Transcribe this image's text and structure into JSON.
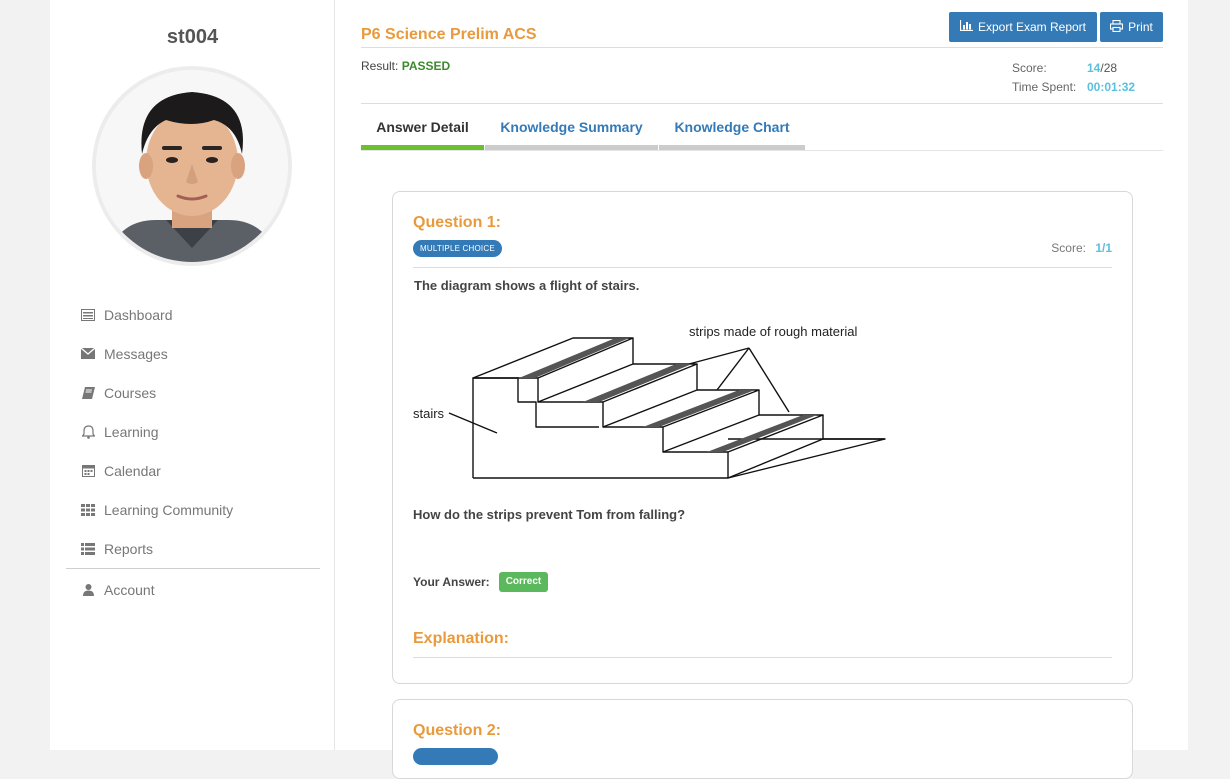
{
  "sidebar": {
    "username": "st004",
    "nav": [
      {
        "label": "Dashboard",
        "icon": "dashboard-icon"
      },
      {
        "label": "Messages",
        "icon": "envelope-icon"
      },
      {
        "label": "Courses",
        "icon": "book-icon"
      },
      {
        "label": "Learning",
        "icon": "bell-icon"
      },
      {
        "label": "Calendar",
        "icon": "calendar-icon"
      },
      {
        "label": "Learning Community",
        "icon": "grid-icon"
      },
      {
        "label": "Reports",
        "icon": "list-icon"
      }
    ],
    "account": {
      "label": "Account",
      "icon": "user-icon"
    }
  },
  "header": {
    "exam_title": "P6 Science Prelim ACS",
    "export_label": "Export Exam Report",
    "print_label": "Print",
    "result_label": "Result:",
    "result_value": "PASSED",
    "score_label": "Score:",
    "score_value": "14",
    "score_total": "/28",
    "time_label": "Time Spent:",
    "time_value": "00:01:32"
  },
  "tabs": [
    {
      "label": "Answer Detail",
      "active": true
    },
    {
      "label": "Knowledge Summary",
      "active": false
    },
    {
      "label": "Knowledge Chart",
      "active": false
    }
  ],
  "question1": {
    "title": "Question 1:",
    "type_badge": "MULTIPLE CHOICE",
    "score_label": "Score:",
    "score_value": "1/1",
    "text": "The diagram shows a flight of stairs.",
    "diagram_labels": {
      "strips": "strips made of rough material",
      "stairs": "stairs"
    },
    "prompt": "How do the strips prevent Tom from falling?",
    "your_answer_label": "Your Answer:",
    "answer_status": "Correct",
    "explanation_title": "Explanation:"
  },
  "question2": {
    "title": "Question 2:"
  },
  "colors": {
    "accent_orange": "#e89a3c",
    "primary_blue": "#337ab7",
    "success_green": "#5cb85c",
    "active_tab_bar": "#6cbf2f",
    "info_blue": "#5bc0de"
  }
}
